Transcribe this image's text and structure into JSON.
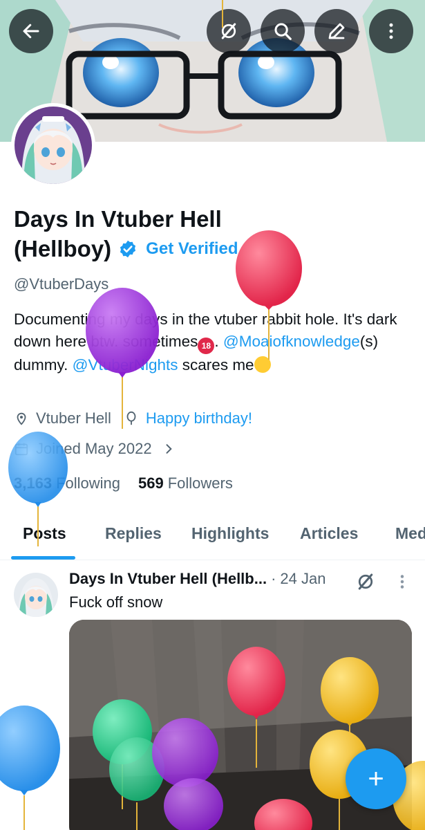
{
  "header": {
    "back_icon": "arrow-left-icon",
    "grok_icon": "grok-icon",
    "search_icon": "search-icon",
    "edit_icon": "pencil-icon",
    "more_icon": "more-vertical-icon"
  },
  "profile": {
    "name_line1": "Days In Vtuber Hell",
    "name_line2": "(Hellboy)",
    "get_verified": "Get Verified",
    "handle": "@VtuberDays",
    "bio": {
      "part1": "Documenting my days in the vtuber rabbit hole. It's dark down here btw. sometimes",
      "part1_end": ".",
      "mention1": "@Moaiofknowledge",
      "part2": "(s) dummy.",
      "mention2": "@VtuberNights",
      "part3": "scares me"
    },
    "location": "Vtuber Hell",
    "birthday": "Happy birthday!",
    "joined": "Joined May 2022",
    "following_count": "3,163",
    "following_label": "Following",
    "followers_count": "569",
    "followers_label": "Followers"
  },
  "tabs": [
    "Posts",
    "Replies",
    "Highlights",
    "Articles",
    "Media"
  ],
  "post": {
    "author": "Days In Vtuber Hell (Hellb...",
    "separator": "·",
    "date": "24 Jan",
    "text": "Fuck off snow"
  },
  "colors": {
    "accent": "#1d9bf0",
    "text": "#0f1419",
    "secondary": "#536471",
    "balloon_red": "#f0435e",
    "balloon_purple": "#a538e6",
    "balloon_blue": "#3aa4f5",
    "balloon_green": "#2bd08f",
    "balloon_yellow": "#f5c42a"
  }
}
